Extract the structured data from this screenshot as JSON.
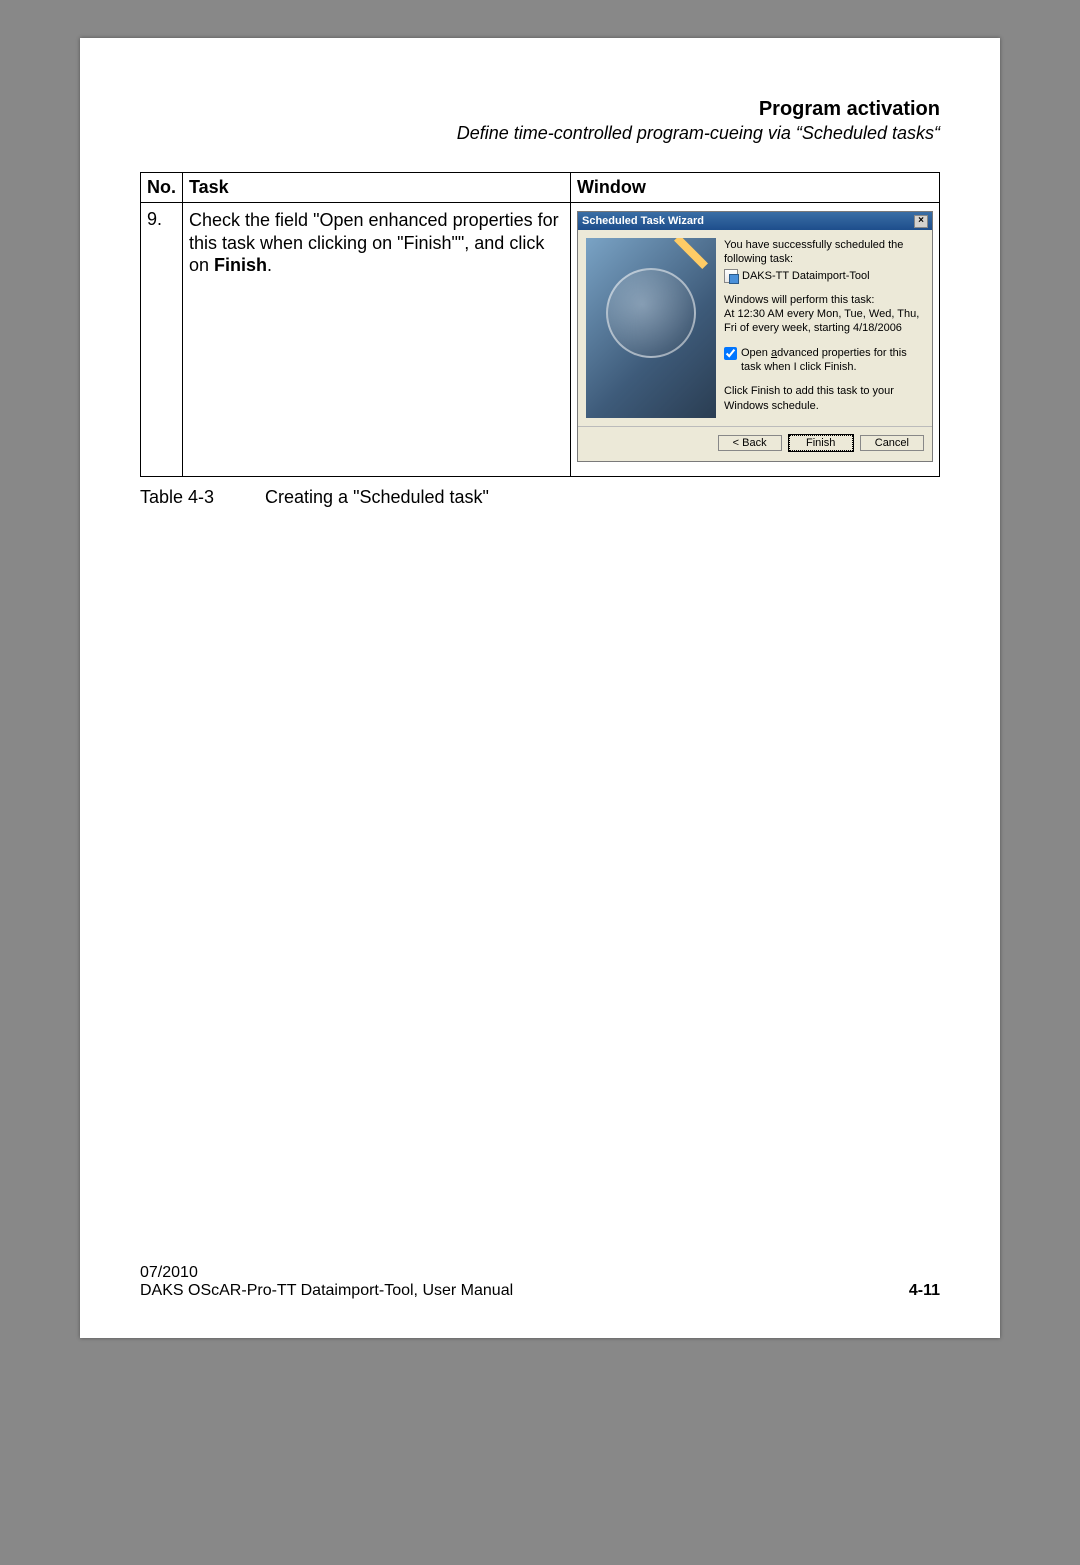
{
  "header": {
    "title": "Program activation",
    "subtitle": "Define time-controlled program-cueing via “Scheduled tasks“"
  },
  "table": {
    "headers": {
      "no": "No.",
      "task": "Task",
      "window": "Window"
    },
    "row": {
      "no": "9.",
      "task_pre": "Check the field \"Open enhanced properties for this task when clicking on \"Finish\"\", and click on ",
      "task_bold": "Finish",
      "task_post": "."
    }
  },
  "wizard": {
    "title": "Scheduled Task Wizard",
    "line1": "You have successfully scheduled the following task:",
    "task_name": "DAKS-TT Dataimport-Tool",
    "line2": "Windows will perform this task:",
    "schedule": "At 12:30 AM every Mon, Tue, Wed, Thu, Fri of every week, starting 4/18/2006",
    "checkbox_pre": "Open ",
    "checkbox_mid": "a",
    "checkbox_rest": "dvanced properties for this task when I click Finish.",
    "line3": "Click Finish to add this task to your Windows schedule.",
    "buttons": {
      "back_pre": "< ",
      "back_u": "B",
      "back_rest": "ack",
      "finish": "Finish",
      "cancel": "Cancel"
    },
    "checkbox_checked": true
  },
  "caption": {
    "label": "Table 4-3",
    "text": "Creating a \"Scheduled task\""
  },
  "footer": {
    "date": "07/2010",
    "doc": "DAKS OScAR-Pro-TT Dataimport-Tool, User Manual",
    "page": "4-11"
  }
}
